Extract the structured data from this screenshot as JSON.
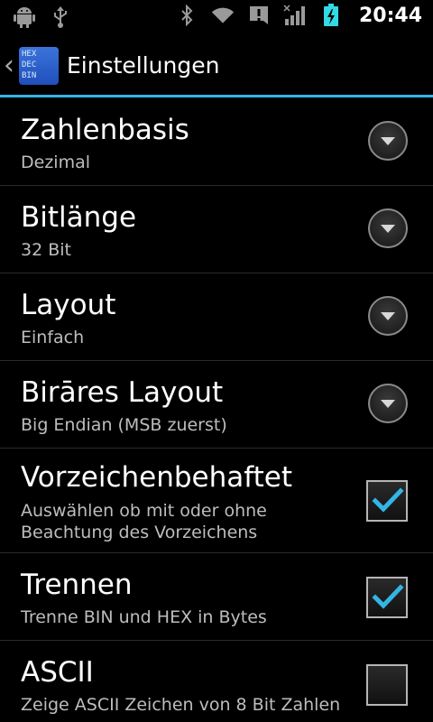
{
  "status_bar": {
    "time": "20:44",
    "left_icons": [
      "android-icon",
      "usb-icon"
    ],
    "right_icons": [
      "bluetooth-icon",
      "wifi-icon",
      "alert-icon",
      "signal-icon",
      "battery-charging-icon"
    ]
  },
  "action_bar": {
    "icon_lines": [
      "HEX",
      "DEC",
      "BIN"
    ],
    "title": "Einstellungen",
    "accent_color": "#33b5e5"
  },
  "preferences": [
    {
      "title": "Zahlenbasis",
      "summary": "Dezimal",
      "control": "dropdown"
    },
    {
      "title": "Bitlänge",
      "summary": "32 Bit",
      "control": "dropdown"
    },
    {
      "title": "Layout",
      "summary": "Einfach",
      "control": "dropdown"
    },
    {
      "title": "Birāres Layout",
      "summary": "Big Endian (MSB zuerst)",
      "control": "dropdown"
    },
    {
      "title": "Vorzeichenbehaftet",
      "summary_line1": "Auswählen ob mit oder ohne",
      "summary_line2": "Beachtung des Vorzeichens",
      "control": "checkbox",
      "checked": true
    },
    {
      "title": "Trennen",
      "summary": "Trenne BIN und HEX in Bytes",
      "control": "checkbox",
      "checked": true
    },
    {
      "title": "ASCII",
      "summary": "Zeige ASCII Zeichen von 8 Bit Zahlen",
      "control": "checkbox",
      "checked": false
    }
  ],
  "check_color": "#33b5e5"
}
